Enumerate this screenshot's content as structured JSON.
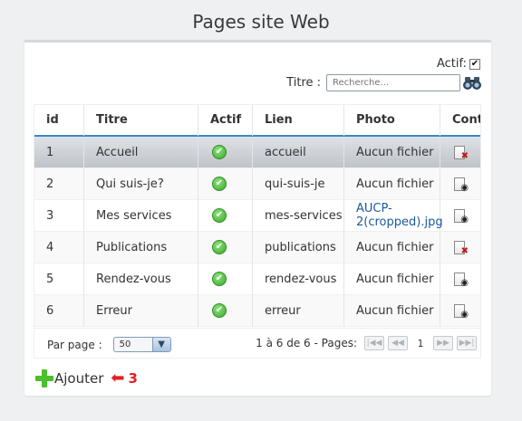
{
  "page": {
    "title": "Pages site Web"
  },
  "filters": {
    "actif_label": "Actif:",
    "actif_checked": true,
    "titre_label": "Titre :",
    "search_placeholder": "Recherche..."
  },
  "table": {
    "columns": [
      "id",
      "Titre",
      "Actif",
      "Lien",
      "Photo",
      "Cont"
    ],
    "rows": [
      {
        "id": "1",
        "titre": "Accueil",
        "actif": "check-icon",
        "lien": "accueil",
        "photo_line1": "Aucun fichier",
        "photo_line2": "",
        "cont": "document-delete-icon",
        "selected": true
      },
      {
        "id": "2",
        "titre": "Qui suis-je?",
        "actif": "check-icon",
        "lien": "qui-suis-je",
        "photo_line1": "Aucun fichier",
        "photo_line2": "",
        "cont": "document-view-icon"
      },
      {
        "id": "3",
        "titre": "Mes services",
        "actif": "check-icon",
        "lien": "mes-services",
        "photo_line1": "AUCP-",
        "photo_line2": "2(cropped).jpg",
        "cont": "document-view-icon"
      },
      {
        "id": "4",
        "titre": "Publications",
        "actif": "check-icon",
        "lien": "publications",
        "photo_line1": "Aucun fichier",
        "photo_line2": "",
        "cont": "document-delete-icon"
      },
      {
        "id": "5",
        "titre": "Rendez-vous",
        "actif": "check-icon",
        "lien": "rendez-vous",
        "photo_line1": "Aucun fichier",
        "photo_line2": "",
        "cont": "document-view-icon"
      },
      {
        "id": "6",
        "titre": "Erreur",
        "actif": "check-icon",
        "lien": "erreur",
        "photo_line1": "Aucun fichier",
        "photo_line2": "",
        "cont": "document-view-icon"
      }
    ]
  },
  "footer": {
    "per_page_label": "Par page :",
    "per_page_value": "50",
    "summary": "1 à 6 de 6 - Pages:",
    "current_page": "1"
  },
  "actions": {
    "add_label": "Ajouter",
    "annotation_count": "3"
  },
  "colors": {
    "accent": "#3b88c4",
    "ok": "#3aa82a",
    "danger": "#e02020",
    "add": "#4cc02c"
  }
}
